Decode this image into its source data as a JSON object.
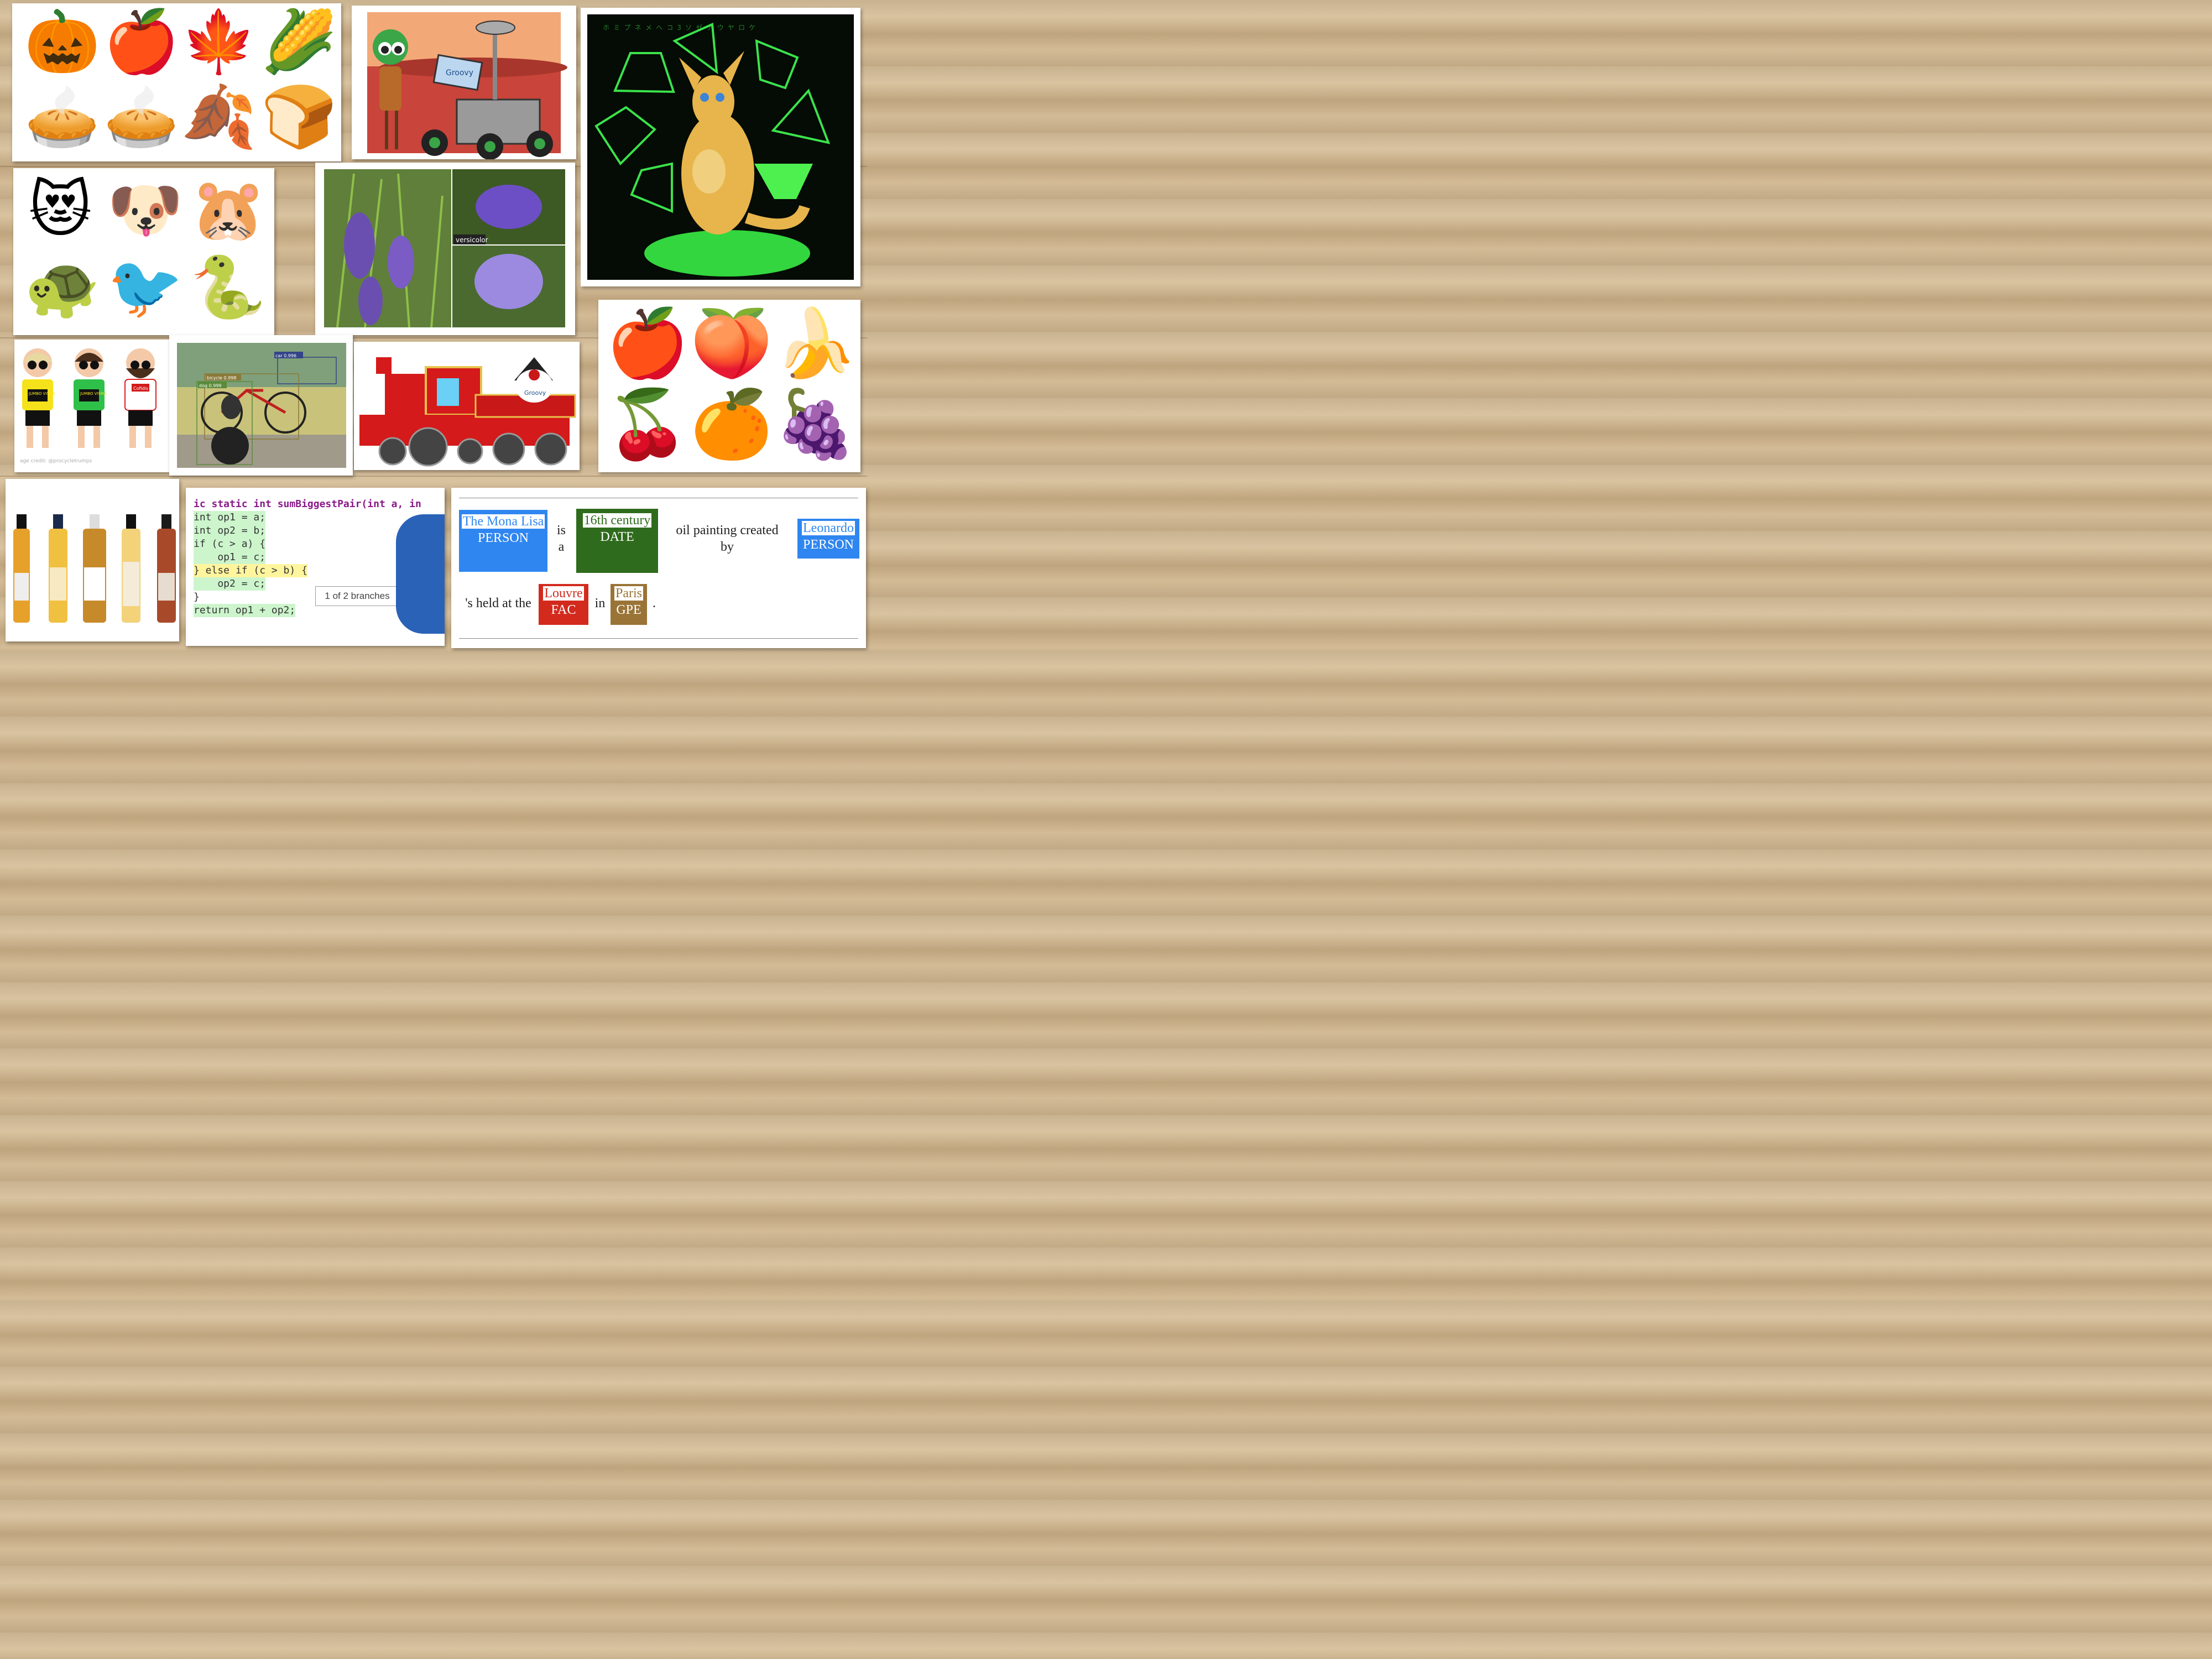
{
  "image_tiles": {
    "autumn": {
      "icons": [
        "pumpkin-icon",
        "apple-icon",
        "maple-leaf-icon",
        "corn-icon",
        "pie-icon",
        "pie-icon",
        "fallen-leaves-icon",
        "bread-icon"
      ],
      "glyphs": [
        "🎃",
        "🍎",
        "🍁",
        "🌽",
        "🥧",
        "🥧",
        "🍂",
        "🍞"
      ]
    },
    "rover": {
      "badge_text": "Groovy"
    },
    "kangaroo": {
      "matrix_chars": "ホ ミ プ ネ メ ヘ コ 3 ソ ゼ ア ウ ヤ ロ ケ"
    },
    "animals": {
      "icons": [
        "heart-eyes-cat-icon",
        "dog-icon",
        "hamster-icon",
        "turtle-icon",
        "bird-icon",
        "snake-icon"
      ],
      "glyphs": [
        "😻",
        "🐶",
        "🐹",
        "🐢",
        "🐦",
        "🐍"
      ]
    },
    "iris": {
      "label": "versicolor"
    },
    "cyclists": {
      "credit": "age credit: @procycletrumps",
      "jersey_1": "JUMBO VISMA",
      "jersey_2": "JUMBO VISMA",
      "jersey_3": "Cofidis"
    },
    "detection": {
      "label_car": "car 0.996",
      "label_bicycle": "bicycle 0.998",
      "label_dog": "dog 0.999"
    },
    "train": {
      "badge_text": "Groovy"
    },
    "fruit": {
      "icons": [
        "apple-icon",
        "peach-icon",
        "banana-icon",
        "cherries-icon",
        "tangerine-icon",
        "grapes-icon"
      ],
      "glyphs": [
        "🍎",
        "🍑",
        "🍌",
        "🍒",
        "🍊",
        "🍇"
      ]
    },
    "bottles": {
      "count": 5
    }
  },
  "code_tile": {
    "line_1": "ic static int sumBiggestPair(int a, in",
    "line_2": "int op1 = a;",
    "line_3": "int op2 = b;",
    "line_4": "if (c > a) {",
    "line_5": "    op1 = c;",
    "line_6": "} else if (c > b) {",
    "line_7": "    op2 = c;",
    "line_8": "}",
    "line_9": "return op1 + op2;",
    "tooltip": "1 of 2 branches",
    "colors": {
      "covered": "#ccf5cc",
      "partial": "#fff59d"
    }
  },
  "ner_tile": {
    "entities": [
      {
        "text": "The Mona Lisa",
        "label": "PERSON",
        "color": "#2f86f0"
      },
      {
        "text": "16th century",
        "label": "DATE",
        "color": "#2f6b1c"
      },
      {
        "text": "Leonardo",
        "label": "PERSON",
        "color": "#2f86f0"
      },
      {
        "text": "Louvre",
        "label": "FAC",
        "color": "#d32a1e"
      },
      {
        "text": "Paris",
        "label": "GPE",
        "color": "#9a7436"
      }
    ],
    "words": {
      "w1": "is a",
      "w2": "oil painting created by",
      "w3": "'s held at the",
      "w4": "in",
      "w5": "."
    }
  }
}
